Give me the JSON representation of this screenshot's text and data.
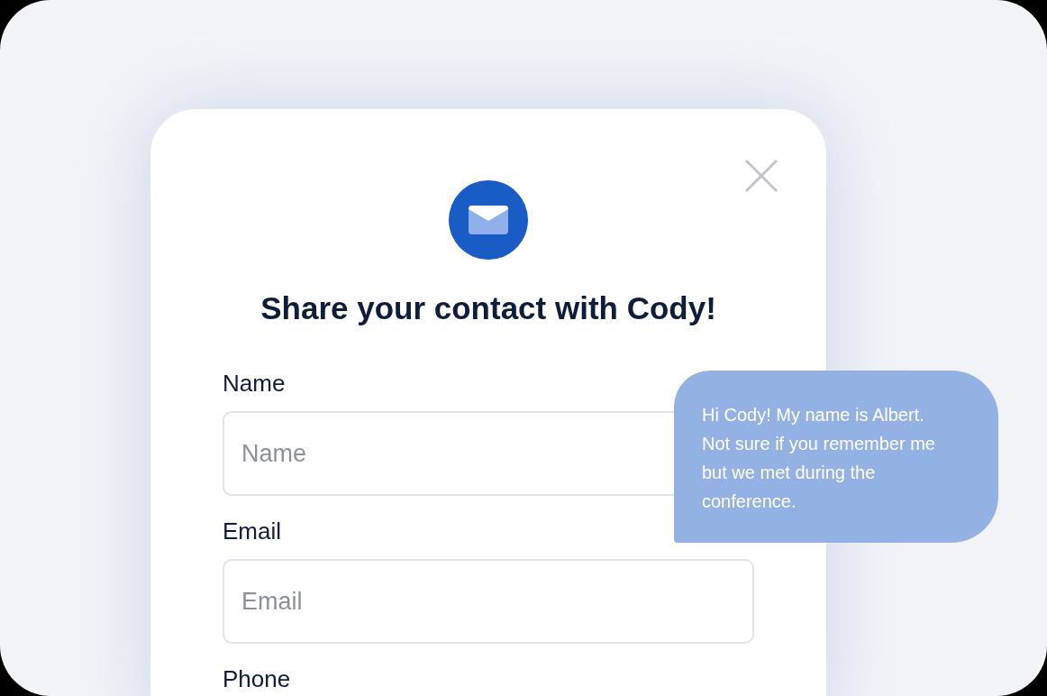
{
  "dialog": {
    "title": "Share your contact with Cody!",
    "fields": [
      {
        "label": "Name",
        "placeholder": "Name"
      },
      {
        "label": "Email",
        "placeholder": "Email"
      },
      {
        "label": "Phone"
      }
    ]
  },
  "chat_bubble": {
    "text": "Hi Cody! My name is Albert. Not sure if you remember me but we met during the conference."
  }
}
